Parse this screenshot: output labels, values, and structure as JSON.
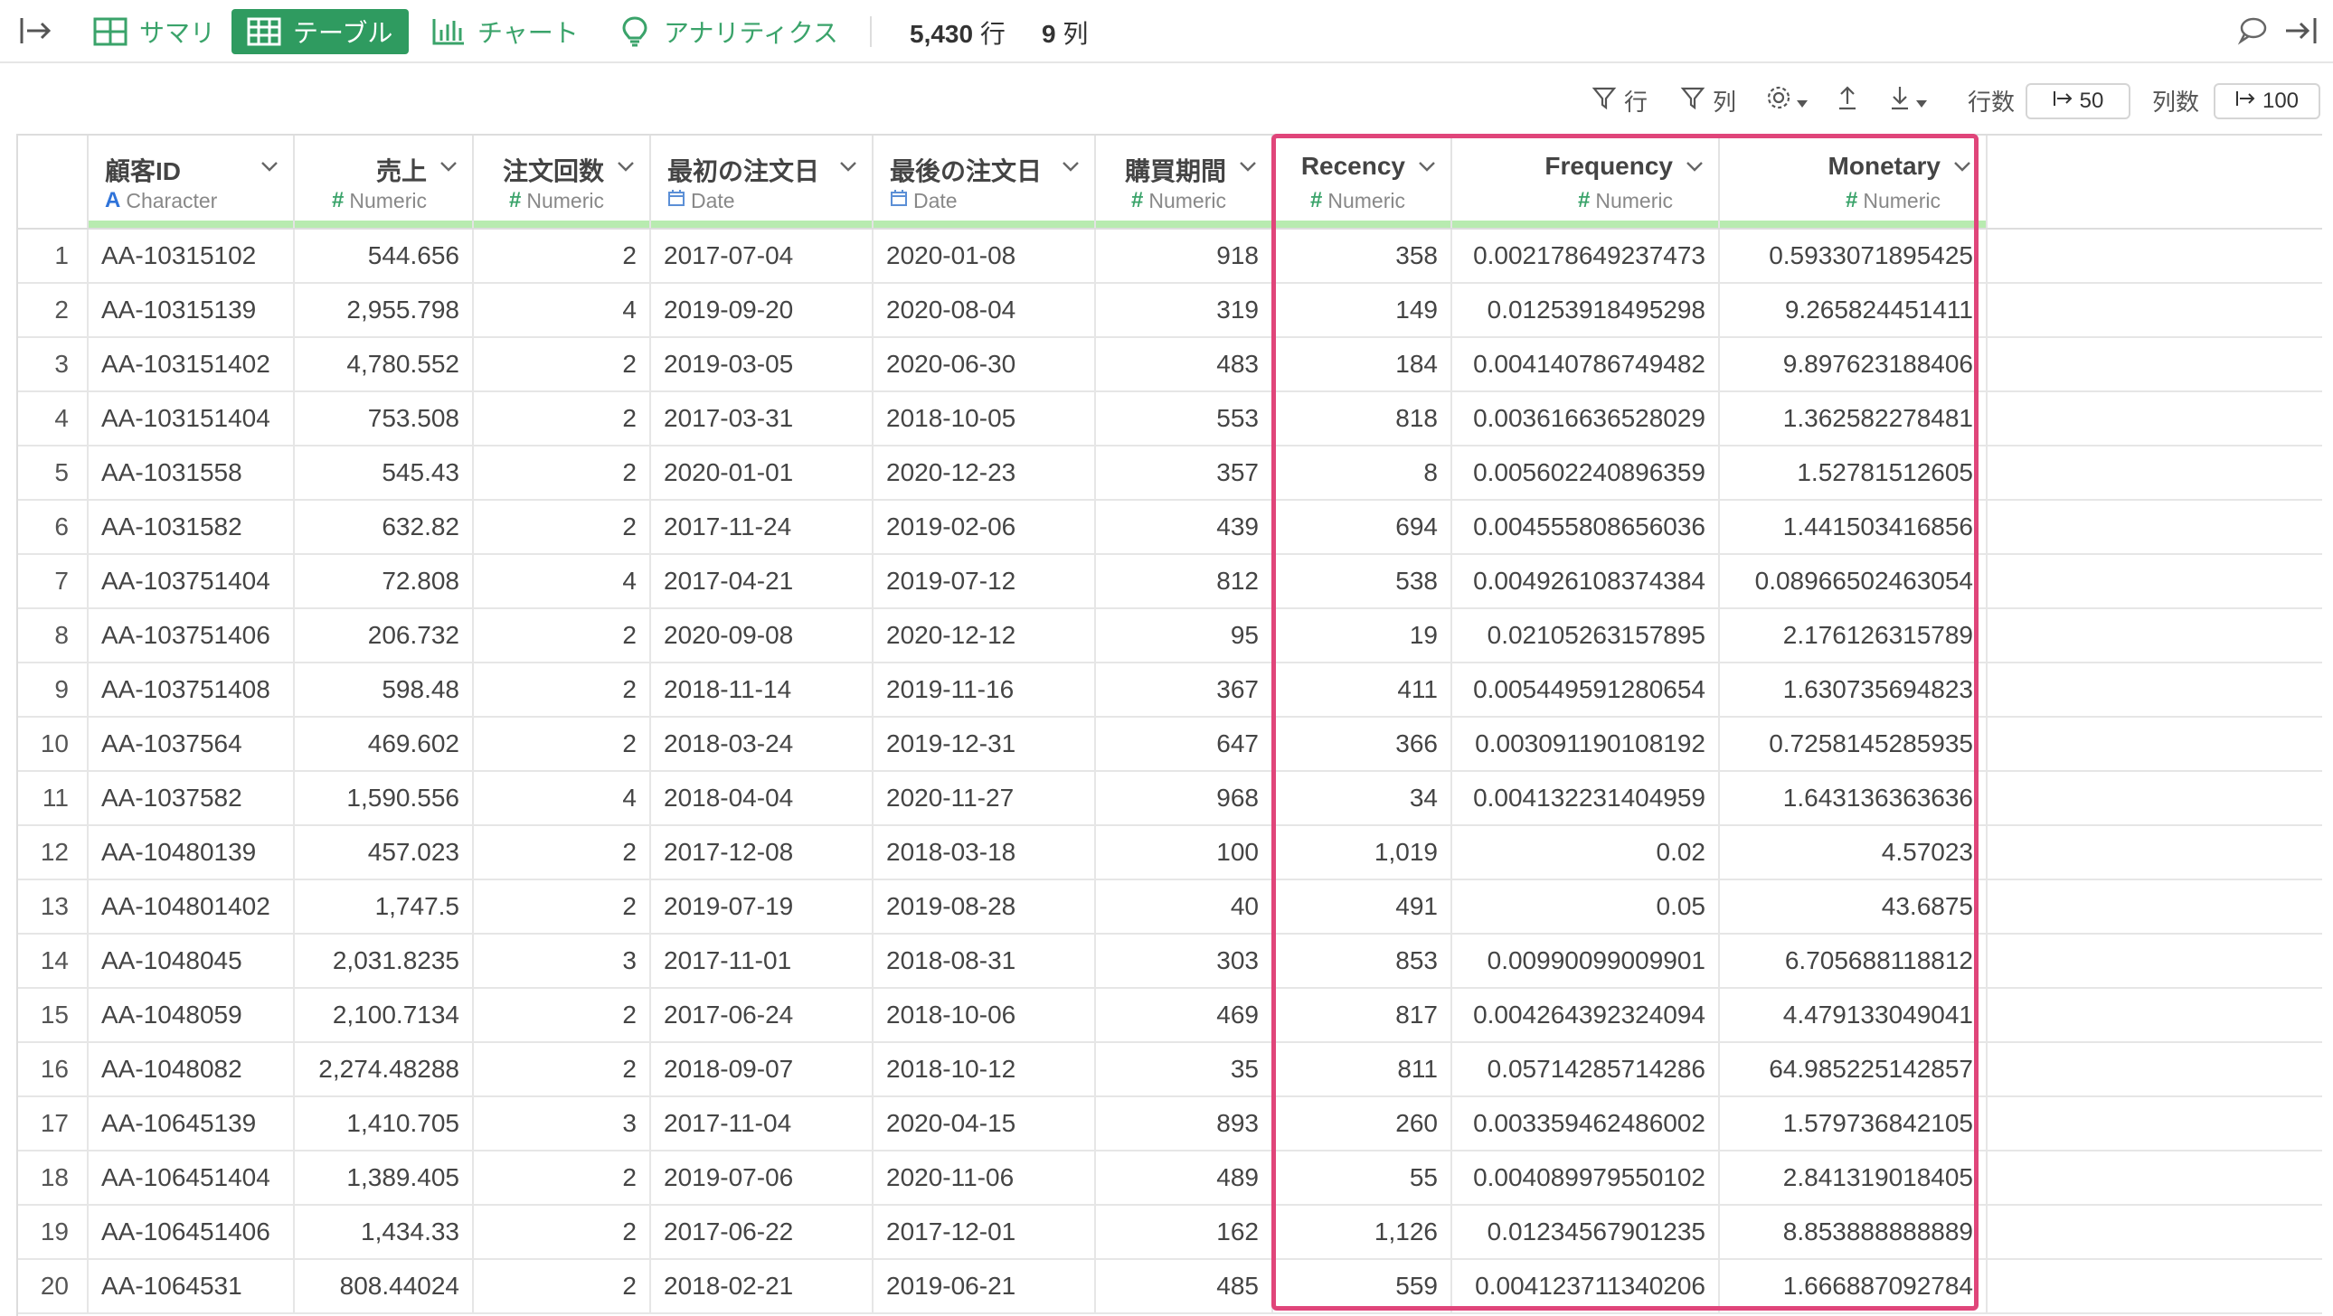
{
  "topbar": {
    "tabs": [
      {
        "id": "summary",
        "label": "サマリ"
      },
      {
        "id": "table",
        "label": "テーブル"
      },
      {
        "id": "chart",
        "label": "チャート"
      },
      {
        "id": "analytics",
        "label": "アナリティクス"
      }
    ],
    "rows_value": "5,430",
    "rows_unit": "行",
    "cols_value": "9",
    "cols_unit": "列"
  },
  "toolbar": {
    "row_filter_label": "行",
    "col_filter_label": "列",
    "row_count_label": "行数",
    "row_count_value": "50",
    "col_count_label": "列数",
    "col_count_value": "100"
  },
  "columns": [
    {
      "name": "顧客ID",
      "type": "Character",
      "type_icon": "A"
    },
    {
      "name": "売上",
      "type": "Numeric",
      "type_icon": "#"
    },
    {
      "name": "注文回数",
      "type": "Numeric",
      "type_icon": "#"
    },
    {
      "name": "最初の注文日",
      "type": "Date",
      "type_icon": "calendar"
    },
    {
      "name": "最後の注文日",
      "type": "Date",
      "type_icon": "calendar"
    },
    {
      "name": "購買期間",
      "type": "Numeric",
      "type_icon": "#"
    },
    {
      "name": "Recency",
      "type": "Numeric",
      "type_icon": "#"
    },
    {
      "name": "Frequency",
      "type": "Numeric",
      "type_icon": "#"
    },
    {
      "name": "Monetary",
      "type": "Numeric",
      "type_icon": "#"
    }
  ],
  "rows": [
    [
      "1",
      "AA-10315102",
      "544.656",
      "2",
      "2017-07-04",
      "2020-01-08",
      "918",
      "358",
      "0.002178649237473",
      "0.5933071895425"
    ],
    [
      "2",
      "AA-10315139",
      "2,955.798",
      "4",
      "2019-09-20",
      "2020-08-04",
      "319",
      "149",
      "0.01253918495298",
      "9.265824451411"
    ],
    [
      "3",
      "AA-103151402",
      "4,780.552",
      "2",
      "2019-03-05",
      "2020-06-30",
      "483",
      "184",
      "0.004140786749482",
      "9.897623188406"
    ],
    [
      "4",
      "AA-103151404",
      "753.508",
      "2",
      "2017-03-31",
      "2018-10-05",
      "553",
      "818",
      "0.003616636528029",
      "1.362582278481"
    ],
    [
      "5",
      "AA-1031558",
      "545.43",
      "2",
      "2020-01-01",
      "2020-12-23",
      "357",
      "8",
      "0.005602240896359",
      "1.52781512605"
    ],
    [
      "6",
      "AA-1031582",
      "632.82",
      "2",
      "2017-11-24",
      "2019-02-06",
      "439",
      "694",
      "0.004555808656036",
      "1.441503416856"
    ],
    [
      "7",
      "AA-103751404",
      "72.808",
      "4",
      "2017-04-21",
      "2019-07-12",
      "812",
      "538",
      "0.004926108374384",
      "0.08966502463054"
    ],
    [
      "8",
      "AA-103751406",
      "206.732",
      "2",
      "2020-09-08",
      "2020-12-12",
      "95",
      "19",
      "0.02105263157895",
      "2.176126315789"
    ],
    [
      "9",
      "AA-103751408",
      "598.48",
      "2",
      "2018-11-14",
      "2019-11-16",
      "367",
      "411",
      "0.005449591280654",
      "1.630735694823"
    ],
    [
      "10",
      "AA-1037564",
      "469.602",
      "2",
      "2018-03-24",
      "2019-12-31",
      "647",
      "366",
      "0.003091190108192",
      "0.7258145285935"
    ],
    [
      "11",
      "AA-1037582",
      "1,590.556",
      "4",
      "2018-04-04",
      "2020-11-27",
      "968",
      "34",
      "0.004132231404959",
      "1.643136363636"
    ],
    [
      "12",
      "AA-10480139",
      "457.023",
      "2",
      "2017-12-08",
      "2018-03-18",
      "100",
      "1,019",
      "0.02",
      "4.57023"
    ],
    [
      "13",
      "AA-104801402",
      "1,747.5",
      "2",
      "2019-07-19",
      "2019-08-28",
      "40",
      "491",
      "0.05",
      "43.6875"
    ],
    [
      "14",
      "AA-1048045",
      "2,031.8235",
      "3",
      "2017-11-01",
      "2018-08-31",
      "303",
      "853",
      "0.00990099009901",
      "6.705688118812"
    ],
    [
      "15",
      "AA-1048059",
      "2,100.7134",
      "2",
      "2017-06-24",
      "2018-10-06",
      "469",
      "817",
      "0.004264392324094",
      "4.479133049041"
    ],
    [
      "16",
      "AA-1048082",
      "2,274.48288",
      "2",
      "2018-09-07",
      "2018-10-12",
      "35",
      "811",
      "0.05714285714286",
      "64.985225142857"
    ],
    [
      "17",
      "AA-10645139",
      "1,410.705",
      "3",
      "2017-11-04",
      "2020-04-15",
      "893",
      "260",
      "0.003359462486002",
      "1.579736842105"
    ],
    [
      "18",
      "AA-106451404",
      "1,389.405",
      "2",
      "2019-07-06",
      "2020-11-06",
      "489",
      "55",
      "0.004089979550102",
      "2.841319018405"
    ],
    [
      "19",
      "AA-106451406",
      "1,434.33",
      "2",
      "2017-06-22",
      "2017-12-01",
      "162",
      "1,126",
      "0.01234567901235",
      "8.853888888889"
    ],
    [
      "20",
      "AA-1064531",
      "808.44024",
      "2",
      "2018-02-21",
      "2019-06-21",
      "485",
      "559",
      "0.004123711340206",
      "1.666887092784"
    ]
  ],
  "colors": {
    "accent": "#2f9b60",
    "highlight": "#e0457a",
    "header_stripe": "#b8ebb0"
  }
}
